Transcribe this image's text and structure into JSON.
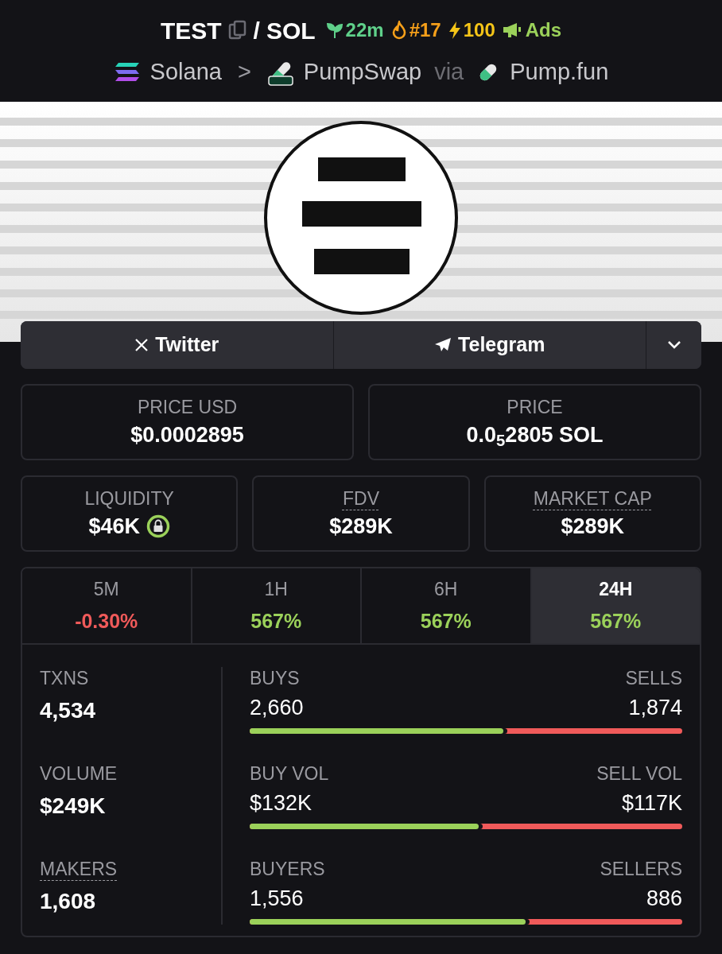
{
  "pair": {
    "base": "TEST",
    "separator": "/",
    "quote": "SOL"
  },
  "badges": [
    {
      "kind": "age",
      "text": "22m"
    },
    {
      "kind": "trending",
      "text": "#17"
    },
    {
      "kind": "boost",
      "text": "100"
    },
    {
      "kind": "ads",
      "text": "Ads"
    }
  ],
  "breadcrumb": {
    "chain": "Solana",
    "separator": ">",
    "dex": "PumpSwap",
    "via": "via",
    "launchpad": "Pump.fun"
  },
  "links": [
    {
      "kind": "twitter",
      "label": "Twitter"
    },
    {
      "kind": "telegram",
      "label": "Telegram"
    }
  ],
  "price_cards": [
    {
      "label": "PRICE USD",
      "value": "$0.0002895"
    },
    {
      "label": "PRICE",
      "value": "0.0$_{5}$2805 SOL"
    }
  ],
  "metric_cards": [
    {
      "label": "LIQUIDITY",
      "value": "$46K",
      "hint": false,
      "locked": true
    },
    {
      "label": "FDV",
      "value": "$289K",
      "hint": true,
      "locked": false
    },
    {
      "label": "MARKET CAP",
      "value": "$289K",
      "hint": true,
      "locked": false
    }
  ],
  "periods": [
    {
      "label": "5M",
      "change": "-0.30%",
      "negative": true,
      "selected": false
    },
    {
      "label": "1H",
      "change": "567%",
      "negative": false,
      "selected": false
    },
    {
      "label": "6H",
      "change": "567%",
      "negative": false,
      "selected": false
    },
    {
      "label": "24H",
      "change": "567%",
      "negative": false,
      "selected": true
    }
  ],
  "totals": [
    {
      "label": "TXNS",
      "value": "4,534",
      "hint": false
    },
    {
      "label": "VOLUME",
      "value": "$249K",
      "hint": false
    },
    {
      "label": "MAKERS",
      "value": "1,608",
      "hint": true
    }
  ],
  "splits": [
    {
      "left_label": "BUYS",
      "left_value": "2,660",
      "right_label": "SELLS",
      "right_value": "1,874",
      "level": 0.587
    },
    {
      "left_label": "BUY VOL",
      "left_value": "$132K",
      "right_label": "SELL VOL",
      "right_value": "$117K",
      "level": 0.53
    },
    {
      "left_label": "BUYERS",
      "left_value": "1,556",
      "right_label": "SELLERS",
      "right_value": "886",
      "level": 0.637
    }
  ]
}
